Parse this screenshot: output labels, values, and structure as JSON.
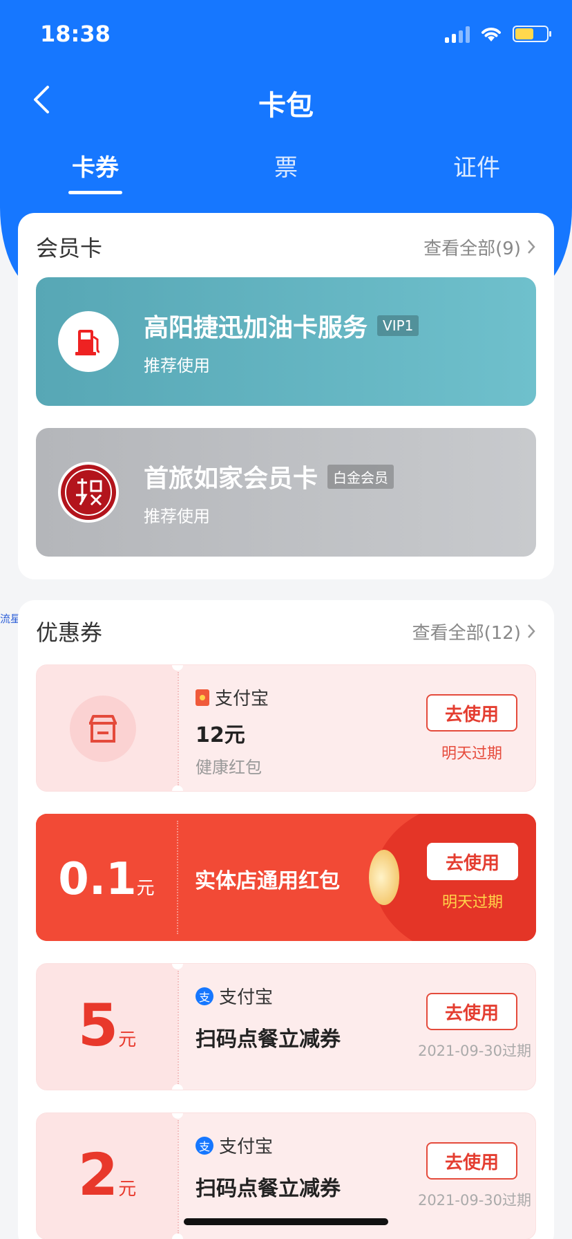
{
  "status": {
    "time": "18:38"
  },
  "nav": {
    "title": "卡包"
  },
  "tabs": [
    {
      "label": "卡券",
      "active": true
    },
    {
      "label": "票",
      "active": false
    },
    {
      "label": "证件",
      "active": false
    }
  ],
  "member": {
    "title": "会员卡",
    "see_all": "查看全部(9)",
    "cards": [
      {
        "name": "高阳捷迅加油卡服务",
        "badge": "VIP1",
        "sub": "推荐使用",
        "color": "#5ab3c4",
        "icon": "fuel-pump-icon"
      },
      {
        "name": "首旅如家会员卡",
        "badge": "白金会员",
        "sub": "推荐使用",
        "color": "#b9bbc0",
        "icon": "seal-logo"
      }
    ]
  },
  "coupons": {
    "title": "优惠券",
    "see_all": "查看全部(12)",
    "items": [
      {
        "brand": "支付宝",
        "value": "12元",
        "desc": "健康红包",
        "button": "去使用",
        "expire": "明天过期",
        "icon": "store-icon"
      },
      {
        "amount": "0.1",
        "unit": "元",
        "title": "实体店通用红包",
        "button": "去使用",
        "expire": "明天过期"
      },
      {
        "amount": "5",
        "unit": "元",
        "brand": "支付宝",
        "title": "扫码点餐立减券",
        "button": "去使用",
        "expire": "2021-09-30过期"
      },
      {
        "amount": "2",
        "unit": "元",
        "brand": "支付宝",
        "title": "扫码点餐立减券",
        "button": "去使用",
        "expire": "2021-09-30过期"
      }
    ]
  },
  "watermark": "流星社区",
  "colors": {
    "primary": "#1677ff",
    "coupon_red": "#f24a36",
    "accent_red": "#e43d30"
  }
}
